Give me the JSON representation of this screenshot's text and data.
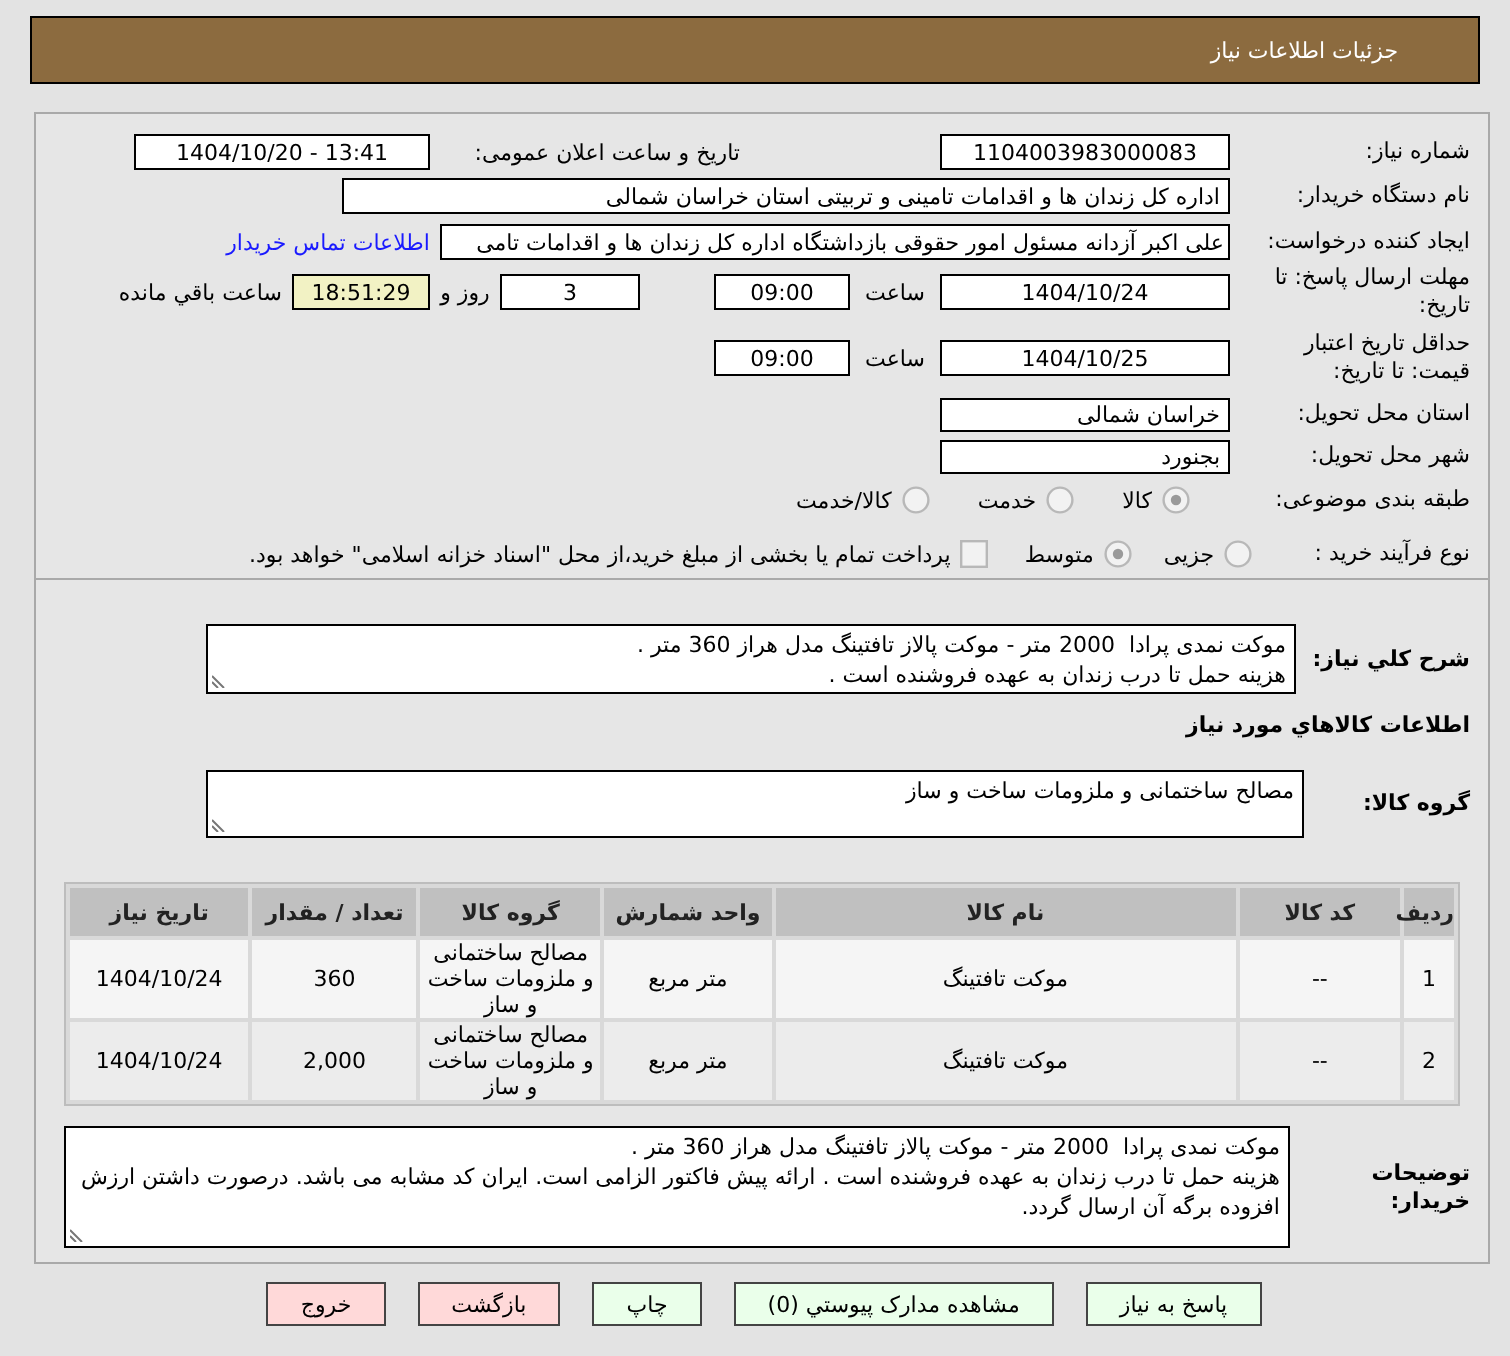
{
  "header": {
    "title": "جزئیات اطلاعات نیاز"
  },
  "details": {
    "need_number": {
      "label": "شماره نیاز:",
      "value": "1104003983000083"
    },
    "announce_datetime": {
      "label": "تاریخ و ساعت اعلان عمومی:",
      "value": "1404/10/20 - 13:41"
    },
    "buyer_org": {
      "label": "نام دستگاه خریدار:",
      "value": "اداره کل زندان ها و اقدامات تامینی و تربیتی استان خراسان شمالی"
    },
    "requester": {
      "label": "ایجاد کننده درخواست:",
      "value": "علی اکبر  آزدانه مسئول امور حقوقی بازداشتگاه اداره کل زندان ها و اقدامات تامی",
      "contact_link": "اطلاعات تماس خریدار"
    },
    "response_deadline": {
      "label": "مهلت ارسال پاسخ: تا تاریخ:",
      "date": "1404/10/24",
      "time_label": "ساعت",
      "time": "09:00",
      "days": "3",
      "days_label": "روز و",
      "remaining": "18:51:29",
      "remaining_label": "ساعت باقي مانده"
    },
    "price_validity": {
      "label": "حداقل تاریخ اعتبار قیمت: تا تاریخ:",
      "date": "1404/10/25",
      "time_label": "ساعت",
      "time": "09:00"
    },
    "delivery_province": {
      "label": "استان محل تحویل:",
      "value": "خراسان شمالی"
    },
    "delivery_city": {
      "label": "شهر محل تحویل:",
      "value": "بجنورد"
    },
    "subject_category": {
      "label": "طبقه بندی موضوعی:",
      "options": [
        {
          "label": "کالا",
          "selected": true
        },
        {
          "label": "خدمت",
          "selected": false
        },
        {
          "label": "کالا/خدمت",
          "selected": false
        }
      ]
    },
    "purchase_process": {
      "label": "نوع فرآیند خرید :",
      "options": [
        {
          "label": "جزیی",
          "selected": false
        },
        {
          "label": "متوسط",
          "selected": true
        }
      ],
      "treasury_payment": {
        "label": "پرداخت تمام یا بخشی از مبلغ خرید،از محل \"اسناد خزانه اسلامی\" خواهد بود.",
        "checked": false
      }
    }
  },
  "need_summary": {
    "label": "شرح کلي نياز:",
    "value": "موکت نمدی پرادا  2000 متر - موکت پالاز تافتینگ مدل هراز 360 متر .\nهزینه حمل تا درب زندان به عهده فروشنده است ."
  },
  "goods_heading": "اطلاعات کالاهاي مورد نياز",
  "goods_group": {
    "label": "گروه کالا:",
    "value": "مصالح ساختمانی و ملزومات ساخت و ساز"
  },
  "table": {
    "columns": [
      "ردیف",
      "کد کالا",
      "نام کالا",
      "واحد شمارش",
      "گروه کالا",
      "تعداد / مقدار",
      "تاریخ نیاز"
    ],
    "rows": [
      [
        "1",
        "--",
        "موکت تافتینگ",
        "متر مربع",
        "مصالح ساختمانی و ملزومات ساخت و ساز",
        "360",
        "1404/10/24"
      ],
      [
        "2",
        "--",
        "موکت تافتینگ",
        "متر مربع",
        "مصالح ساختمانی و ملزومات ساخت و ساز",
        "2,000",
        "1404/10/24"
      ]
    ]
  },
  "buyer_notes": {
    "label": "توضیحات خریدار:",
    "value": "موکت نمدی پرادا  2000 متر - موکت پالاز تافتینگ مدل هراز 360 متر .\nهزینه حمل تا درب زندان به عهده فروشنده است . ارائه پیش فاکتور الزامی است. ایران کد مشابه می باشد. درصورت داشتن ارزش افزوده برگه آن ارسال گردد."
  },
  "buttons": [
    {
      "label": "پاسخ به نیاز",
      "kind": "primary"
    },
    {
      "label": "مشاهده مدارک پیوستي (0)",
      "kind": "primary"
    },
    {
      "label": "چاپ",
      "kind": "primary"
    },
    {
      "label": "بازگشت",
      "kind": "danger"
    },
    {
      "label": "خروج",
      "kind": "danger"
    }
  ]
}
